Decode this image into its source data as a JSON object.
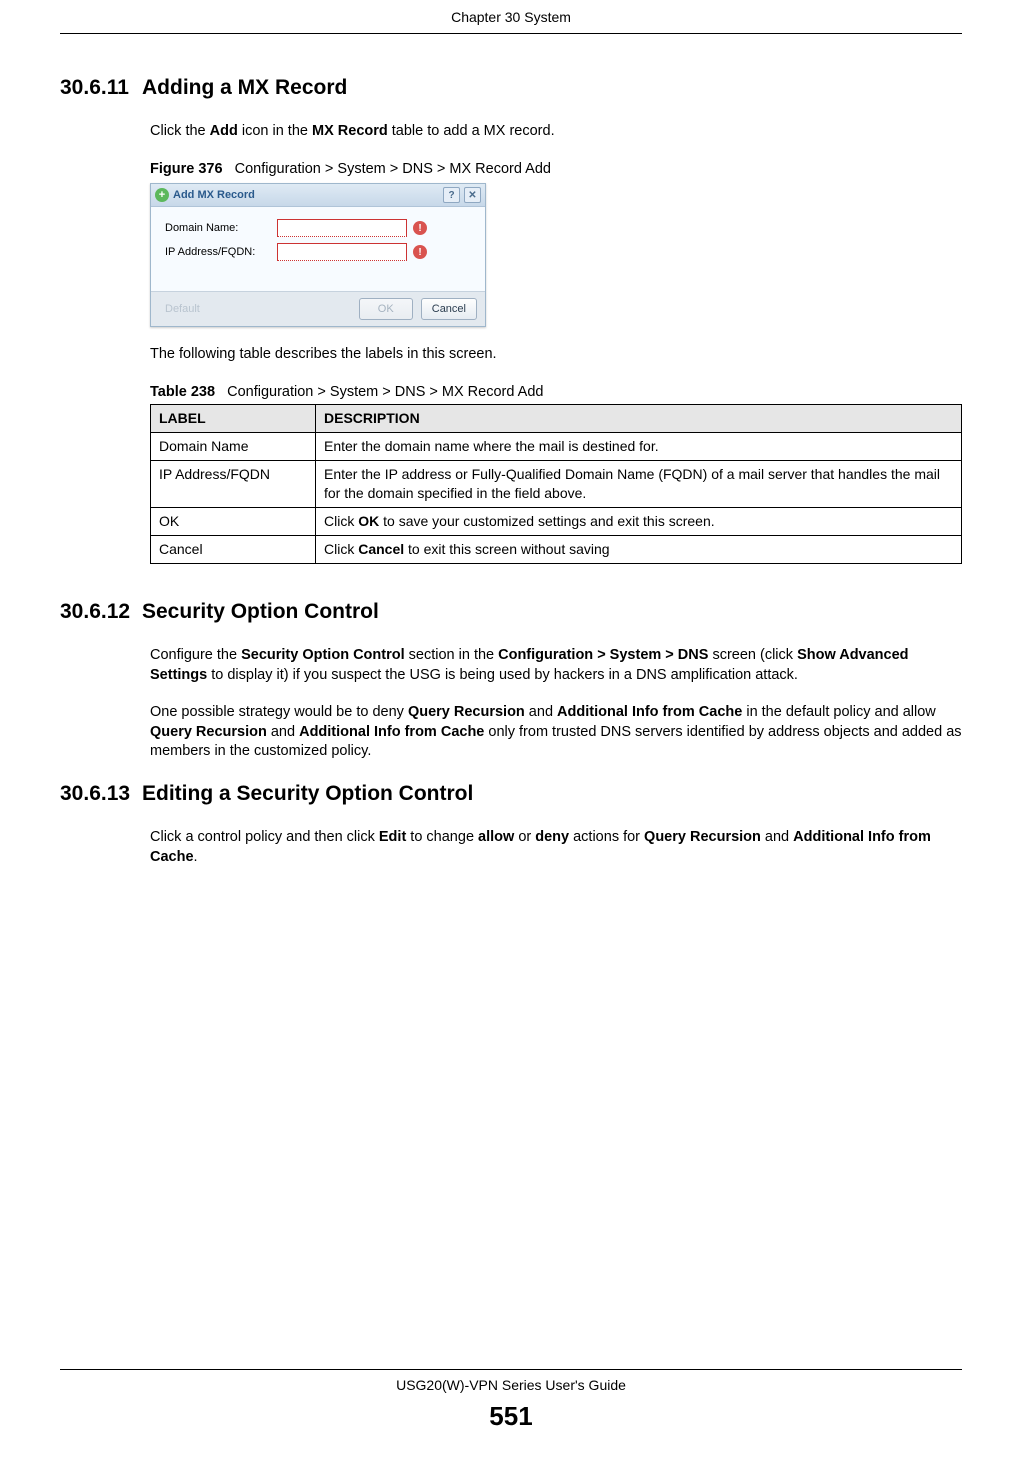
{
  "header": {
    "chapter": "Chapter 30 System"
  },
  "sec1": {
    "num": "30.6.11",
    "title": "Adding a MX Record",
    "p1_a": "Click the ",
    "p1_b": "Add",
    "p1_c": " icon in the ",
    "p1_d": "MX Record",
    "p1_e": " table to add a MX record.",
    "fig_label": "Figure 376",
    "fig_caption": "Configuration > System > DNS > MX Record Add",
    "dialog": {
      "title": "Add MX Record",
      "domain_label": "Domain Name:",
      "domain_value": "",
      "ip_label": "IP Address/FQDN:",
      "ip_value": "",
      "default_btn": "Default",
      "ok_btn": "OK",
      "cancel_btn": "Cancel"
    },
    "after_fig": "The following table describes the labels in this screen.",
    "tbl_label": "Table 238",
    "tbl_caption": "Configuration > System > DNS > MX Record Add",
    "th_label": "LABEL",
    "th_desc": "DESCRIPTION",
    "rows": [
      {
        "label": "Domain Name",
        "desc": "Enter the domain name where the mail is destined for."
      },
      {
        "label": "IP Address/FQDN",
        "desc": "Enter the IP address or Fully-Qualified Domain Name (FQDN) of a mail server that handles the mail for the domain specified in the field above."
      },
      {
        "label": "OK",
        "desc_a": "Click ",
        "desc_b": "OK",
        "desc_c": " to save your customized settings and exit this screen."
      },
      {
        "label": "Cancel",
        "desc_a": "Click ",
        "desc_b": "Cancel",
        "desc_c": " to exit this screen without saving"
      }
    ]
  },
  "sec2": {
    "num": "30.6.12",
    "title": "Security Option Control",
    "p1_a": "Configure the ",
    "p1_b": "Security Option Control",
    "p1_c": " section in the ",
    "p1_d": "Configuration > System > DNS",
    "p1_e": " screen (click ",
    "p1_f": "Show Advanced Settings",
    "p1_g": " to display it) if you suspect the USG is being used by hackers in a DNS amplification attack.",
    "p2_a": "One possible strategy would be to deny ",
    "p2_b": "Query Recursion",
    "p2_c": " and ",
    "p2_d": "Additional Info from Cache",
    "p2_e": " in the default policy and allow ",
    "p2_f": "Query Recursion",
    "p2_g": " and ",
    "p2_h": "Additional Info from Cache",
    "p2_i": " only from trusted DNS servers identified by address objects and added as members in the customized policy."
  },
  "sec3": {
    "num": "30.6.13",
    "title": "Editing a Security Option Control",
    "p1_a": "Click a control policy and then click ",
    "p1_b": "Edit",
    "p1_c": " to change ",
    "p1_d": "allow",
    "p1_e": " or ",
    "p1_f": "deny",
    "p1_g": " actions for ",
    "p1_h": "Query Recursion",
    "p1_i": " and ",
    "p1_j": "Additional Info from Cache",
    "p1_k": "."
  },
  "footer": {
    "guide": "USG20(W)-VPN Series User's Guide",
    "page": "551"
  }
}
